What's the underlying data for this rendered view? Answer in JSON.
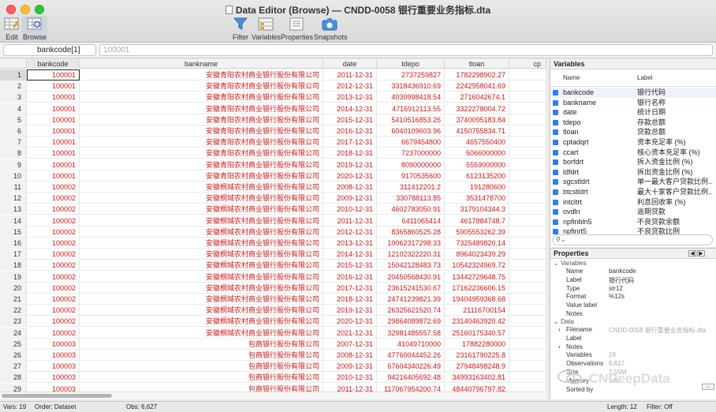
{
  "window": {
    "title": "Data Editor (Browse) — CNDD-0058 银行重要业务指标.dta"
  },
  "toolbar": {
    "left": [
      {
        "label": "Edit",
        "icon": "table-edit-icon"
      },
      {
        "label": "Browse",
        "icon": "table-browse-icon"
      }
    ],
    "center": [
      {
        "label": "Filter",
        "icon": "filter-icon"
      },
      {
        "label": "Variables",
        "icon": "variables-icon"
      },
      {
        "label": "Properties",
        "icon": "properties-icon"
      },
      {
        "label": "Snapshots",
        "icon": "camera-icon"
      }
    ]
  },
  "command": {
    "cell_name": "bankcode[1]",
    "cell_value": "100001"
  },
  "grid": {
    "columns": [
      "bankcode",
      "bankname",
      "date",
      "tdepo",
      "tloan",
      "cp"
    ],
    "rows": [
      [
        "1",
        "100001",
        "安徽青阳农村商业银行股份有限公司",
        "2011-12-31",
        "2737259827",
        "1782298902.27"
      ],
      [
        "2",
        "100001",
        "安徽青阳农村商业银行股份有限公司",
        "2012-12-31",
        "3318436910.69",
        "2242958041.69"
      ],
      [
        "3",
        "100001",
        "安徽青阳农村商业银行股份有限公司",
        "2013-12-31",
        "4030998418.54",
        "2716042674.1"
      ],
      [
        "4",
        "100001",
        "安徽青阳农村商业银行股份有限公司",
        "2014-12-31",
        "4716912113.55",
        "3322278004.72"
      ],
      [
        "5",
        "100001",
        "安徽青阳农村商业银行股份有限公司",
        "2015-12-31",
        "5410516853.26",
        "3740095183.84"
      ],
      [
        "6",
        "100001",
        "安徽青阳农村商业银行股份有限公司",
        "2016-12-31",
        "6040109603.96",
        "4150755834.71"
      ],
      [
        "7",
        "100001",
        "安徽青阳农村商业银行股份有限公司",
        "2017-12-31",
        "6679454800",
        "4657550400"
      ],
      [
        "8",
        "100001",
        "安徽青阳农村商业银行股份有限公司",
        "2018-12-31",
        "7237000000",
        "5066000000"
      ],
      [
        "9",
        "100001",
        "安徽青阳农村商业银行股份有限公司",
        "2019-12-31",
        "8090000000",
        "5559000000"
      ],
      [
        "10",
        "100001",
        "安徽青阳农村商业银行股份有限公司",
        "2020-12-31",
        "9170535600",
        "6123135200"
      ],
      [
        "11",
        "100002",
        "安徽桐城农村商业银行股份有限公司",
        "2008-12-31",
        "311412201.2",
        "191280600"
      ],
      [
        "12",
        "100002",
        "安徽桐城农村商业银行股份有限公司",
        "2009-12-31",
        "330788113.85",
        "3531478700"
      ],
      [
        "13",
        "100002",
        "安徽桐城农村商业银行股份有限公司",
        "2010-12-31",
        "4602783050.91",
        "3179104344.3"
      ],
      [
        "14",
        "100002",
        "安徽桐城农村商业银行股份有限公司",
        "2011-12-31",
        "6411065414",
        "4617884748.7"
      ],
      [
        "15",
        "100002",
        "安徽桐城农村商业银行股份有限公司",
        "2012-12-31",
        "8365860525.28",
        "5905553262.39"
      ],
      [
        "16",
        "100002",
        "安徽桐城农村商业银行股份有限公司",
        "2013-12-31",
        "10062317298.33",
        "7325489820.14"
      ],
      [
        "17",
        "100002",
        "安徽桐城农村商业银行股份有限公司",
        "2014-12-31",
        "12102322220.31",
        "8964023439.29"
      ],
      [
        "18",
        "100002",
        "安徽桐城农村商业银行股份有限公司",
        "2015-12-31",
        "15042128483.73",
        "10542324969.72"
      ],
      [
        "19",
        "100002",
        "安徽桐城农村商业银行股份有限公司",
        "2016-12-31",
        "20450568430.91",
        "13442729648.75"
      ],
      [
        "20",
        "100002",
        "安徽桐城农村商业银行股份有限公司",
        "2017-12-31",
        "23615241530.67",
        "17162236606.15"
      ],
      [
        "21",
        "100002",
        "安徽桐城农村商业银行股份有限公司",
        "2018-12-31",
        "24741239821.39",
        "19404959368.68"
      ],
      [
        "22",
        "100002",
        "安徽桐城农村商业银行股份有限公司",
        "2019-12-31",
        "26325621520.74",
        "21116700154"
      ],
      [
        "23",
        "100002",
        "安徽桐城农村商业银行股份有限公司",
        "2020-12-31",
        "29864089872.69",
        "23140463920.42"
      ],
      [
        "24",
        "100002",
        "安徽桐城农村商业银行股份有限公司",
        "2021-12-31",
        "32981485557.58",
        "25160175340.57"
      ],
      [
        "25",
        "100003",
        "包商银行股份有限公司",
        "2007-12-31",
        "41049710000",
        "17882280000"
      ],
      [
        "26",
        "100003",
        "包商银行股份有限公司",
        "2008-12-31",
        "47760044452.26",
        "23161790225.8"
      ],
      [
        "27",
        "100003",
        "包商银行股份有限公司",
        "2009-12-31",
        "67604340226.49",
        "27948498248.9"
      ],
      [
        "28",
        "100003",
        "包商银行股份有限公司",
        "2010-12-31",
        "94216405692.48",
        "34993163402.81"
      ],
      [
        "29",
        "100003",
        "包商银行股份有限公司",
        "2011-12-31",
        "117067954200.74",
        "48440796797.82"
      ],
      [
        "30",
        "100003",
        "包商银行股份有限公司",
        "2012-12-31",
        "133974330000",
        "58520517000"
      ]
    ]
  },
  "variables_panel": {
    "title": "Variables",
    "col_name": "Name",
    "col_label": "Label",
    "items": [
      {
        "name": "bankcode",
        "label": "银行代码"
      },
      {
        "name": "bankname",
        "label": "银行名称"
      },
      {
        "name": "date",
        "label": "统计日期"
      },
      {
        "name": "tdepo",
        "label": "存款总额"
      },
      {
        "name": "tloan",
        "label": "贷款总额"
      },
      {
        "name": "cptadqrt",
        "label": "资本充足率 (%)"
      },
      {
        "name": "ccart",
        "label": "核心资本充足率 (%)"
      },
      {
        "name": "borfdrt",
        "label": "拆入资金比例 (%)"
      },
      {
        "name": "ldfdrt",
        "label": "拆出资金比例 (%)"
      },
      {
        "name": "sgcstldrt",
        "label": "单一最大客户贷款比例..."
      },
      {
        "name": "btcstldrt",
        "label": "最大十家客户贷款比例..."
      },
      {
        "name": "intcltrt",
        "label": "利息回收率 (%)"
      },
      {
        "name": "ovdln",
        "label": "逾期贷款"
      },
      {
        "name": "npfinbln5",
        "label": "不良贷款余额"
      },
      {
        "name": "npfinrt5",
        "label": "不良贷款比例"
      }
    ],
    "search_placeholder": ""
  },
  "properties_panel": {
    "title": "Properties",
    "variables_section": "Variables",
    "fields": [
      {
        "key": "Name",
        "value": "bankcode"
      },
      {
        "key": "Label",
        "value": "银行代码"
      },
      {
        "key": "Type",
        "value": "str12"
      },
      {
        "key": "Format",
        "value": "%12s"
      },
      {
        "key": "Value label",
        "value": ""
      },
      {
        "key": "Notes",
        "value": ""
      }
    ],
    "data_section": "Data",
    "data_fields": [
      {
        "key": "Filename",
        "value": "CNDD-0058 银行重要业务指标.dta"
      },
      {
        "key": "Label",
        "value": ""
      },
      {
        "key": "Notes",
        "value": ""
      },
      {
        "key": "Variables",
        "value": "19"
      },
      {
        "key": "Observations",
        "value": "6,627"
      },
      {
        "key": "Size",
        "value": "2.55M"
      },
      {
        "key": "Memory",
        "value": "64M"
      },
      {
        "key": "Sorted by",
        "value": ""
      }
    ]
  },
  "watermark": "CNDeepData",
  "status": {
    "vars": "Vars: 19",
    "order": "Order: Dataset",
    "obs": "Obs: 6,627",
    "length": "Length: 12",
    "filter": "Filter: Off"
  },
  "colors": {
    "data_text": "#d01616",
    "checkbox": "#2f7cf6"
  }
}
